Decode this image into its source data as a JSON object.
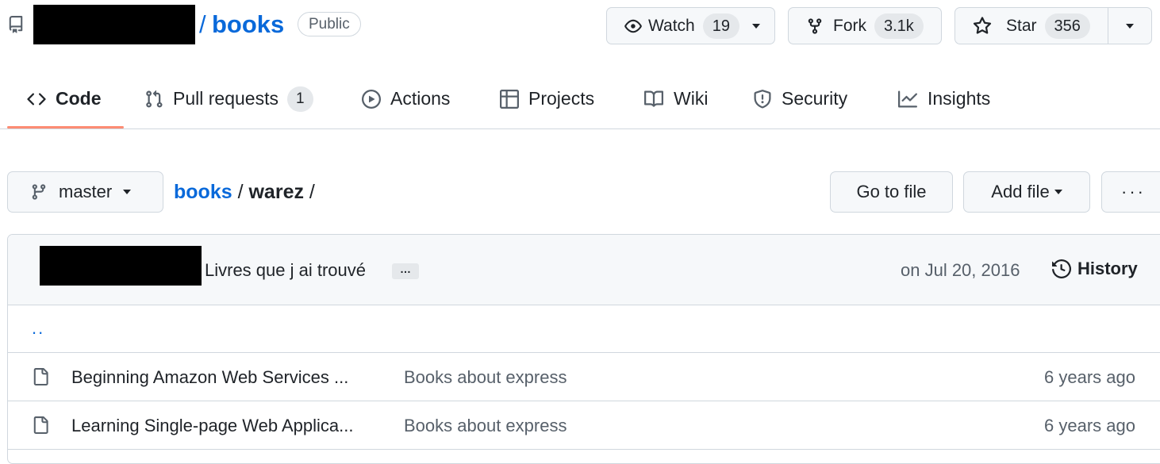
{
  "repo": {
    "slash": "/",
    "name": "books",
    "visibility": "Public"
  },
  "actions": {
    "watch_label": "Watch",
    "watch_count": "19",
    "fork_label": "Fork",
    "fork_count": "3.1k",
    "star_label": "Star",
    "star_count": "356"
  },
  "nav": {
    "tabs": [
      {
        "label": "Code",
        "icon": "code-icon",
        "active": true
      },
      {
        "label": "Pull requests",
        "icon": "pull-request-icon",
        "count": "1"
      },
      {
        "label": "Actions",
        "icon": "play-icon"
      },
      {
        "label": "Projects",
        "icon": "table-icon"
      },
      {
        "label": "Wiki",
        "icon": "book-icon"
      },
      {
        "label": "Security",
        "icon": "shield-icon"
      },
      {
        "label": "Insights",
        "icon": "graph-icon"
      }
    ]
  },
  "filenav": {
    "branch": "master",
    "path": [
      {
        "label": "books",
        "link": true
      },
      {
        "label": "warez",
        "link": false
      }
    ],
    "sep": "/",
    "goto_label": "Go to file",
    "add_label": "Add file",
    "more_label": "···"
  },
  "commit": {
    "message": "Livres que j ai trouvé",
    "ellipsis": "…",
    "date": "on Jul 20, 2016",
    "history_label": "History"
  },
  "files": {
    "parent": "..",
    "rows": [
      {
        "name": "Beginning Amazon Web Services ...",
        "commit": "Books about express",
        "age": "6 years ago"
      },
      {
        "name": "Learning Single-page Web Applica...",
        "commit": "Books about express",
        "age": "6 years ago"
      }
    ]
  },
  "colors": {
    "link": "#0969da",
    "tab_underline": "#fd8c73",
    "border": "#d0d7de",
    "muted_text": "#57606a"
  }
}
